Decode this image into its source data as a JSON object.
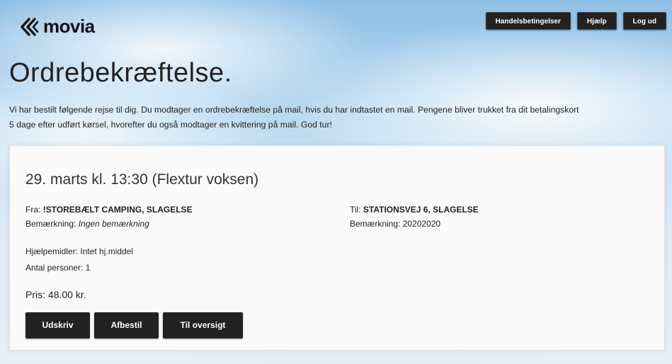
{
  "header": {
    "logo_text": "movia",
    "nav": {
      "terms_label": "Handelsbetingelser",
      "help_label": "Hjælp",
      "logout_label": "Log ud"
    }
  },
  "page": {
    "title": "Ordrebekræftelse.",
    "intro_line1": "Vi har bestilt følgende rejse til dig. Du modtager en ordrebekræftelse på mail, hvis du har indtastet en mail. Pengene bliver trukket fra dit betalingskort",
    "intro_line2": "5 dage efter udført kørsel, hvorefter du også modtager en kvittering på mail. God tur!"
  },
  "booking": {
    "title": "29. marts kl. 13:30 (Flextur voksen)",
    "from_label": "Fra:",
    "from_value": "!STOREBÆLT CAMPING, SLAGELSE",
    "from_note_label": "Bemærkning:",
    "from_note_value": "Ingen bemærkning",
    "to_label": "Til:",
    "to_value": "STATIONSVEJ 6, SLAGELSE",
    "to_note_label": "Bemærkning:",
    "to_note_value": "20202020",
    "aids": "Hjælpemidler: Intet hj.middel",
    "persons": "Antal personer: 1",
    "price": "Pris: 48.00 kr."
  },
  "actions": {
    "print_label": "Udskriv",
    "cancel_label": "Afbestil",
    "overview_label": "Til oversigt"
  },
  "colors": {
    "button_bg": "#222222",
    "button_text": "#ffffff",
    "card_bg": "#fafafa"
  }
}
